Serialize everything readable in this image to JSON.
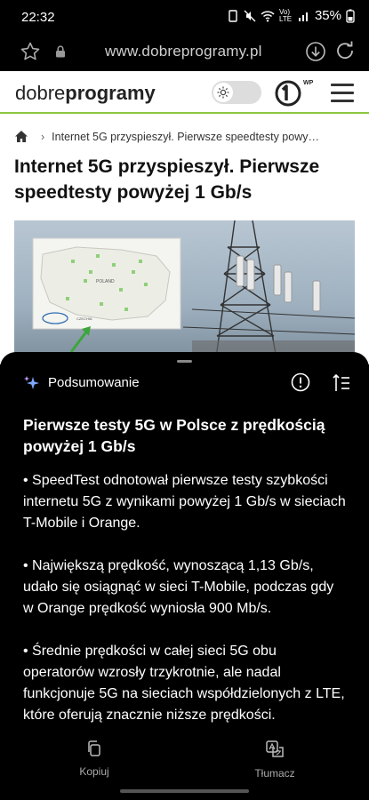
{
  "status_bar": {
    "time": "22:32",
    "network": "Vo) LTE",
    "battery": "35%"
  },
  "browser": {
    "url": "www.dobreprogramy.pl"
  },
  "site": {
    "logo_regular": "dobre",
    "logo_bold": "programy",
    "brand_badge": "WP",
    "accent_color": "#8dc63f"
  },
  "breadcrumb": {
    "text": "Internet 5G przyspieszył. Pierwsze speedtesty powy…"
  },
  "article": {
    "title": "Internet 5G przyspieszył. Pierwsze speedtesty powyżej 1 Gb/s"
  },
  "map_labels": {
    "country": "POLAND",
    "neighbor": "CZECHIA"
  },
  "summary_sheet": {
    "title": "Podsumowanie",
    "heading": "Pierwsze testy 5G w Polsce z prędkością powyżej 1 Gb/s",
    "bullets": [
      "• SpeedTest odnotował pierwsze testy szybkości internetu 5G z wynikami powyżej 1 Gb/s w sieciach T-Mobile i Orange.",
      "• Największą prędkość, wynoszącą 1,13 Gb/s, udało się osiągnąć w sieci T-Mobile, podczas gdy w Orange prędkość wyniosła 900 Mb/s.",
      "• Średnie prędkości w całej sieci 5G obu operatorów wzrosły trzykrotnie, ale nadal funkcjonuje 5G na sieciach współdzielonych z LTE, które oferują znacznie niższe prędkości."
    ],
    "actions": {
      "copy": "Kopiuj",
      "translate": "Tłumacz"
    }
  }
}
